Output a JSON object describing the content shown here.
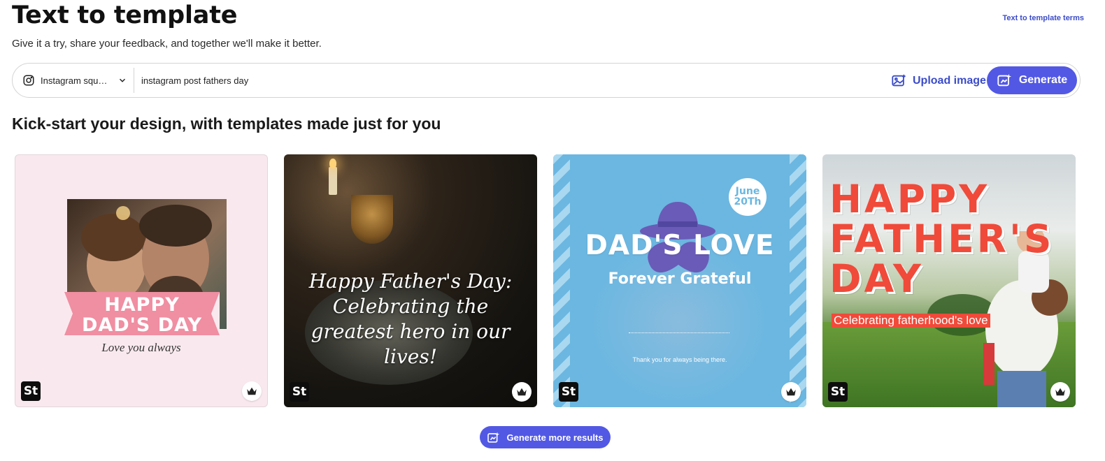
{
  "page": {
    "title": "Text to template",
    "terms_link": "Text to template terms",
    "subtitle": "Give it a try, share your feedback, and together we'll make it better."
  },
  "prompt_bar": {
    "format_label": "Instagram square post",
    "format_icon": "instagram-icon",
    "prompt_value": "instagram post fathers day",
    "upload_label": "Upload image",
    "generate_label": "Generate"
  },
  "section": {
    "title": "Kick-start your design, with templates made just for you"
  },
  "templates": [
    {
      "badge": "St",
      "headline_1": "HAPPY",
      "headline_2": "DAD'S DAY",
      "subline": "Love you always"
    },
    {
      "badge": "St",
      "text": "Happy Father's Day: Celebrating the greatest hero in our lives!"
    },
    {
      "badge": "St",
      "date_1": "June",
      "date_2": "20Th",
      "headline": "DAD'S LOVE",
      "subline": "Forever Grateful",
      "small_text": "Thank you for always being there."
    },
    {
      "badge": "St",
      "title_1": "HAPPY",
      "title_2": "FATHER'S",
      "title_3": "DAY",
      "subline": "Celebrating fatherhood's love"
    }
  ],
  "footer": {
    "more_label": "Generate more results"
  },
  "colors": {
    "accent": "#5258e4",
    "link": "#3b4cc8"
  }
}
